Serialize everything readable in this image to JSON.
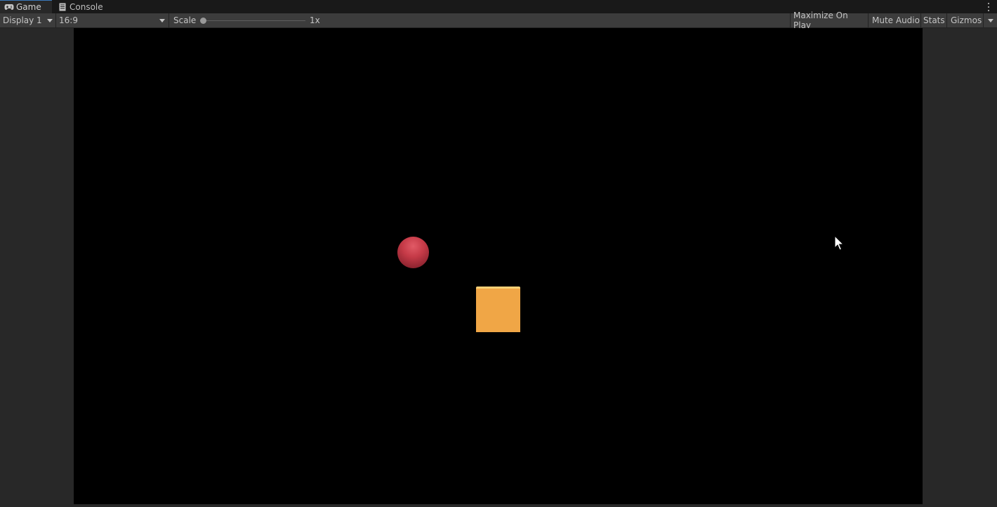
{
  "tabs": [
    {
      "label": "Game",
      "icon": "gamepad-icon",
      "active": true
    },
    {
      "label": "Console",
      "icon": "console-icon",
      "active": false
    }
  ],
  "toolbar": {
    "display": "Display 1",
    "aspect": "16:9",
    "scale_label": "Scale",
    "scale_value": "1x",
    "scale_level": 0,
    "maximize_on_play": "Maximize On Play",
    "mute_audio": "Mute Audio",
    "stats": "Stats",
    "gizmos": "Gizmos"
  },
  "scene": {
    "background": "#000000",
    "sphere_color": "#c53a47",
    "cube_color": "#f0a646"
  },
  "colors": {
    "window_bg": "#282828",
    "tabbar_bg": "#191919",
    "toolbar_bg": "#3c3c3c"
  }
}
